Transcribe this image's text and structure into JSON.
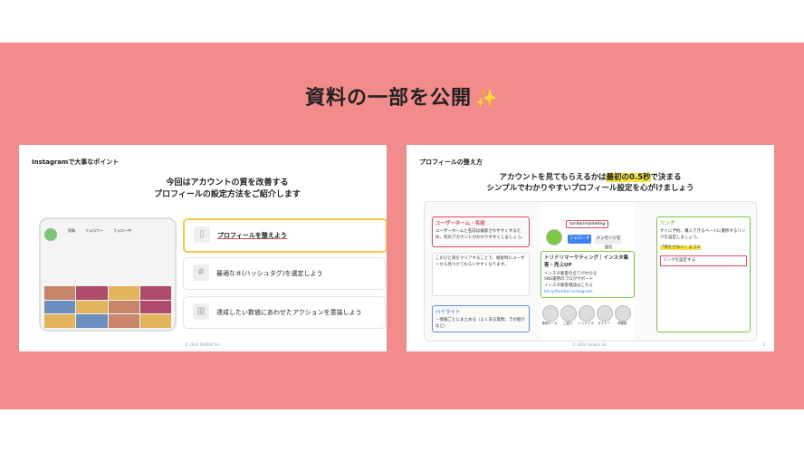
{
  "banner": {
    "title": "資料の一部を公開",
    "sparkle": "✨"
  },
  "slide1": {
    "title": "Instagramで大事なポイント",
    "heading_line1": "今回はアカウントの質を改善する",
    "heading_line2": "プロフィールの設定方法をご紹介します",
    "phone": {
      "stats": [
        "投稿",
        "フォロワー",
        "フォロー中"
      ]
    },
    "cards": [
      {
        "label": "プロフィールを整えよう",
        "icon": "phone-icon",
        "highlighted": true
      },
      {
        "label": "最適な＃(ハッシュタグ)を選定しよう",
        "icon": "hashtag-icon",
        "highlighted": false
      },
      {
        "label": "達成したい数値にあわせたアクションを意識しよう",
        "icon": "chart-icon",
        "highlighted": false
      }
    ],
    "footer": "© 2024 SHIBUP Inc."
  },
  "slide2": {
    "title": "プロフィールの整え方",
    "heading_pre": "アカウントを見てもらえるかは",
    "heading_hl": "最初の0.5秒",
    "heading_post": "で決まる",
    "heading_line2": "シンプルでわかりやすいプロフィール設定を心がけましょう",
    "username_box": {
      "label": "ユーザーネーム・名前",
      "text": "ユーザーネームと名前は検索されやすくするため、何のアカウントかわかりやすくしましょう。"
    },
    "search_box": {
      "text": "このひと目をクリアすることで、検索時にユーザーから見つけてもらいやすくなります。",
      "hl": "見つけてもらいやすく"
    },
    "highlight_box": {
      "label": "ハイライト",
      "text": "・情報ごとにまとめる（よくある質問、ラボ紹介など）"
    },
    "profile": {
      "handle": "toridorimarketing",
      "name": "toridorimarketing",
      "follow": "フォローする",
      "message": "メッセージを送信"
    },
    "bio_box": {
      "label": "トリドリマーケティング｜インスタ集客・売上UP",
      "lines": [
        "インスタ集客の全てがわかる",
        "SNS運用のプロがサポート",
        "インスタ集客相談はこちら",
        "bit.ly/toridori-instagram"
      ]
    },
    "link_box": {
      "label": "リンク",
      "text": "すぐに予約、購入できるページに遷移するリンクを設定しましょう。",
      "hl": "「待たせない」ように",
      "extra": "リンクを設定する"
    },
    "highlights": [
      "事例ケース",
      "ご紹介",
      "トリドリマ",
      "セミナー",
      "沖縄旅"
    ],
    "footer": "© 2024 toridori Inc.",
    "page": "4"
  }
}
